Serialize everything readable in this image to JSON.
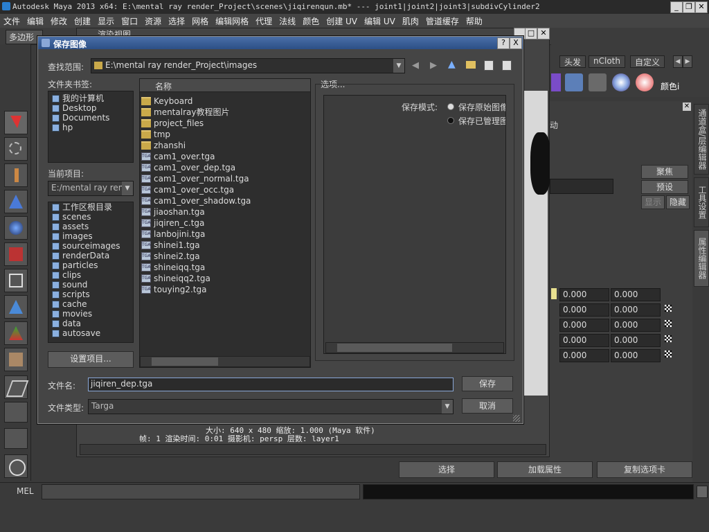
{
  "window": {
    "title": "Autodesk Maya 2013 x64: E:\\mental ray render_Project\\scenes\\jiqirenqun.mb*   ---   joint1|joint2|joint3|subdivCylinder2"
  },
  "menu": [
    "文件",
    "编辑",
    "修改",
    "创建",
    "显示",
    "窗口",
    "资源",
    "选择",
    "网格",
    "编辑网格",
    "代理",
    "法线",
    "颜色",
    "创建 UV",
    "编辑 UV",
    "肌肉",
    "管道缓存",
    "帮助"
  ],
  "toolbar": {
    "mode_dropdown": "多边形"
  },
  "shelf_tabs": {
    "tab1": "头发",
    "tab2": "nCloth",
    "tab3": "自定义"
  },
  "shelf_icon_label": "颜色i",
  "viewport": {
    "title": "渲染视图",
    "stats_line1": "大小: 640 x 480 缩放: 1.000      (Maya 软件)",
    "stats_line2": "帧: 1        渲染时间: 0:01       摄影机: persp       层数: layer1"
  },
  "attr_editor": {
    "buttons": {
      "focus": "聚焦",
      "presets": "预设",
      "show": "显示",
      "hide": "隐藏"
    },
    "side_fragment": "动",
    "rows": [
      [
        "0.000",
        "0.000"
      ],
      [
        "0.000",
        "0.000"
      ],
      [
        "0.000",
        "0.000"
      ],
      [
        "0.000",
        "0.000"
      ],
      [
        "0.000",
        "0.000"
      ]
    ],
    "vtabs": [
      "通道盒/层编辑器",
      "工具设置",
      "属性编辑器"
    ]
  },
  "bottom_buttons": {
    "select": "选择",
    "load_attrs": "加载属性",
    "copy_tab": "复制选项卡"
  },
  "mel_label": "MEL",
  "dialog": {
    "title": "保存图像",
    "lookin_label": "查找范围:",
    "lookin_path": "E:\\mental ray render_Project\\images",
    "bookmarks_label": "文件夹书签:",
    "bookmarks": [
      "我的计算机",
      "Desktop",
      "Documents",
      "hp"
    ],
    "current_project_label": "当前项目:",
    "current_project_value": "E:/mental ray rend",
    "project_dirs": [
      "工作区根目录",
      "scenes",
      "assets",
      "images",
      "sourceimages",
      "renderData",
      "particles",
      "clips",
      "sound",
      "scripts",
      "cache",
      "movies",
      "data",
      "autosave"
    ],
    "set_project_button": "设置项目...",
    "column_name": "名称",
    "folders": [
      "Keyboard",
      "mentalray教程图片",
      "project_files",
      "tmp",
      "zhanshi"
    ],
    "files": [
      "cam1_over.tga",
      "cam1_over_dep.tga",
      "cam1_over_normal.tga",
      "cam1_over_occ.tga",
      "cam1_over_shadow.tga",
      "jiaoshan.tga",
      "jiqiren_c.tga",
      "lanbojini.tga",
      "shinei1.tga",
      "shinei2.tga",
      "shineiqq.tga",
      "shineiqq2.tga",
      "touying2.tga"
    ],
    "options_label": "选项...",
    "save_mode_label": "保存模式:",
    "save_mode_opt1": "保存原始图像",
    "save_mode_opt2": "保存已管理图",
    "filename_label": "文件名:",
    "filename_value": "jiqiren_dep.tga",
    "filetype_label": "文件类型:",
    "filetype_value": "Targa",
    "save_button": "保存",
    "cancel_button": "取消",
    "help_button": "?",
    "close_button": "X",
    "file_icon_text": "TGA"
  }
}
